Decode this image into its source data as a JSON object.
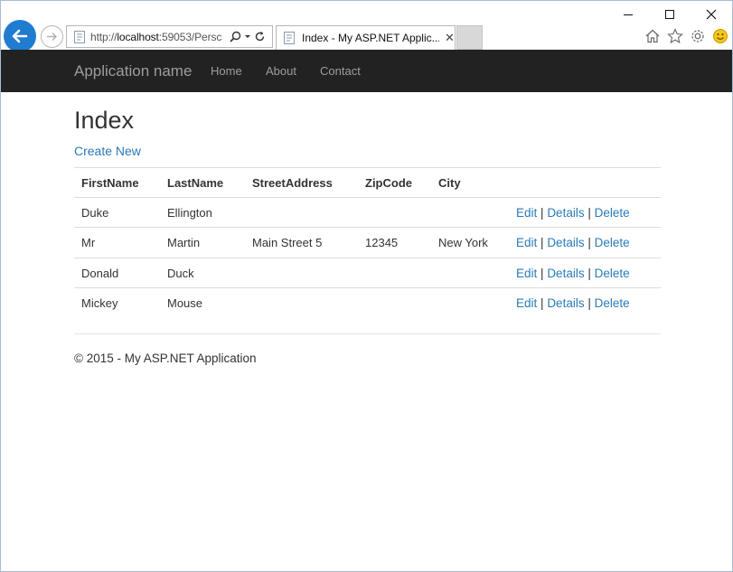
{
  "browser": {
    "url_prefix": "http://",
    "url_host": "localhost",
    "url_rest": ":59053/Persc",
    "tab_title": "Index - My ASP.NET Applic...",
    "tab_close": "✕",
    "accent_color": "#1f7cd1",
    "icons": [
      "back-icon",
      "forward-icon",
      "page-icon",
      "search-icon",
      "dropdown-icon",
      "refresh-icon",
      "home-icon",
      "favorites-icon",
      "settings-icon",
      "smiley-icon"
    ]
  },
  "nav": {
    "brand": "Application name",
    "links": [
      "Home",
      "About",
      "Contact"
    ],
    "background": "#222222"
  },
  "page": {
    "title": "Index",
    "create_new": "Create New",
    "link_color": "#2a7bb8"
  },
  "table": {
    "headers": [
      "FirstName",
      "LastName",
      "StreetAddress",
      "ZipCode",
      "City"
    ],
    "rows": [
      {
        "first": "Duke",
        "last": "Ellington",
        "street": "",
        "zip": "",
        "city": ""
      },
      {
        "first": "Mr",
        "last": "Martin",
        "street": "Main Street 5",
        "zip": "12345",
        "city": "New York"
      },
      {
        "first": "Donald",
        "last": "Duck",
        "street": "",
        "zip": "",
        "city": ""
      },
      {
        "first": "Mickey",
        "last": "Mouse",
        "street": "",
        "zip": "",
        "city": ""
      }
    ],
    "actions": {
      "edit": "Edit",
      "details": "Details",
      "delete": "Delete",
      "separator": "|"
    }
  },
  "footer": {
    "text": "© 2015 - My ASP.NET Application"
  }
}
